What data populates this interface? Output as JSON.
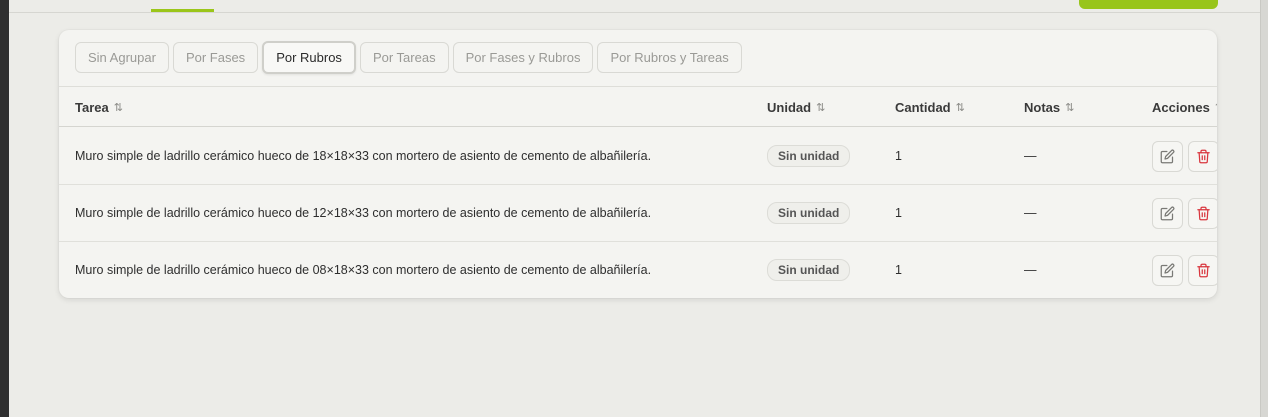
{
  "grouping": {
    "options": [
      {
        "label": "Sin Agrupar",
        "active": false
      },
      {
        "label": "Por Fases",
        "active": false
      },
      {
        "label": "Por Rubros",
        "active": true
      },
      {
        "label": "Por Tareas",
        "active": false
      },
      {
        "label": "Por Fases y Rubros",
        "active": false
      },
      {
        "label": "Por Rubros y Tareas",
        "active": false
      }
    ]
  },
  "table": {
    "columns": {
      "tarea": "Tarea",
      "unidad": "Unidad",
      "cantidad": "Cantidad",
      "notas": "Notas",
      "acciones": "Acciones"
    },
    "sort_icon": "⇅",
    "rows": [
      {
        "tarea": "Muro simple de ladrillo cerámico hueco de 18×18×33 con mortero de asiento de cemento de albañilería.",
        "unidad": "Sin unidad",
        "cantidad": "1",
        "notas": "—"
      },
      {
        "tarea": "Muro simple de ladrillo cerámico hueco de 12×18×33 con mortero de asiento de cemento de albañilería.",
        "unidad": "Sin unidad",
        "cantidad": "1",
        "notas": "—"
      },
      {
        "tarea": "Muro simple de ladrillo cerámico hueco de 08×18×33 con mortero de asiento de cemento de albañilería.",
        "unidad": "Sin unidad",
        "cantidad": "1",
        "notas": "—"
      }
    ]
  },
  "colors": {
    "accent": "#98c51b",
    "delete": "#d9363e",
    "edit": "#7a7a76"
  },
  "icons": {
    "edit": "edit-icon",
    "delete": "trash-icon"
  }
}
